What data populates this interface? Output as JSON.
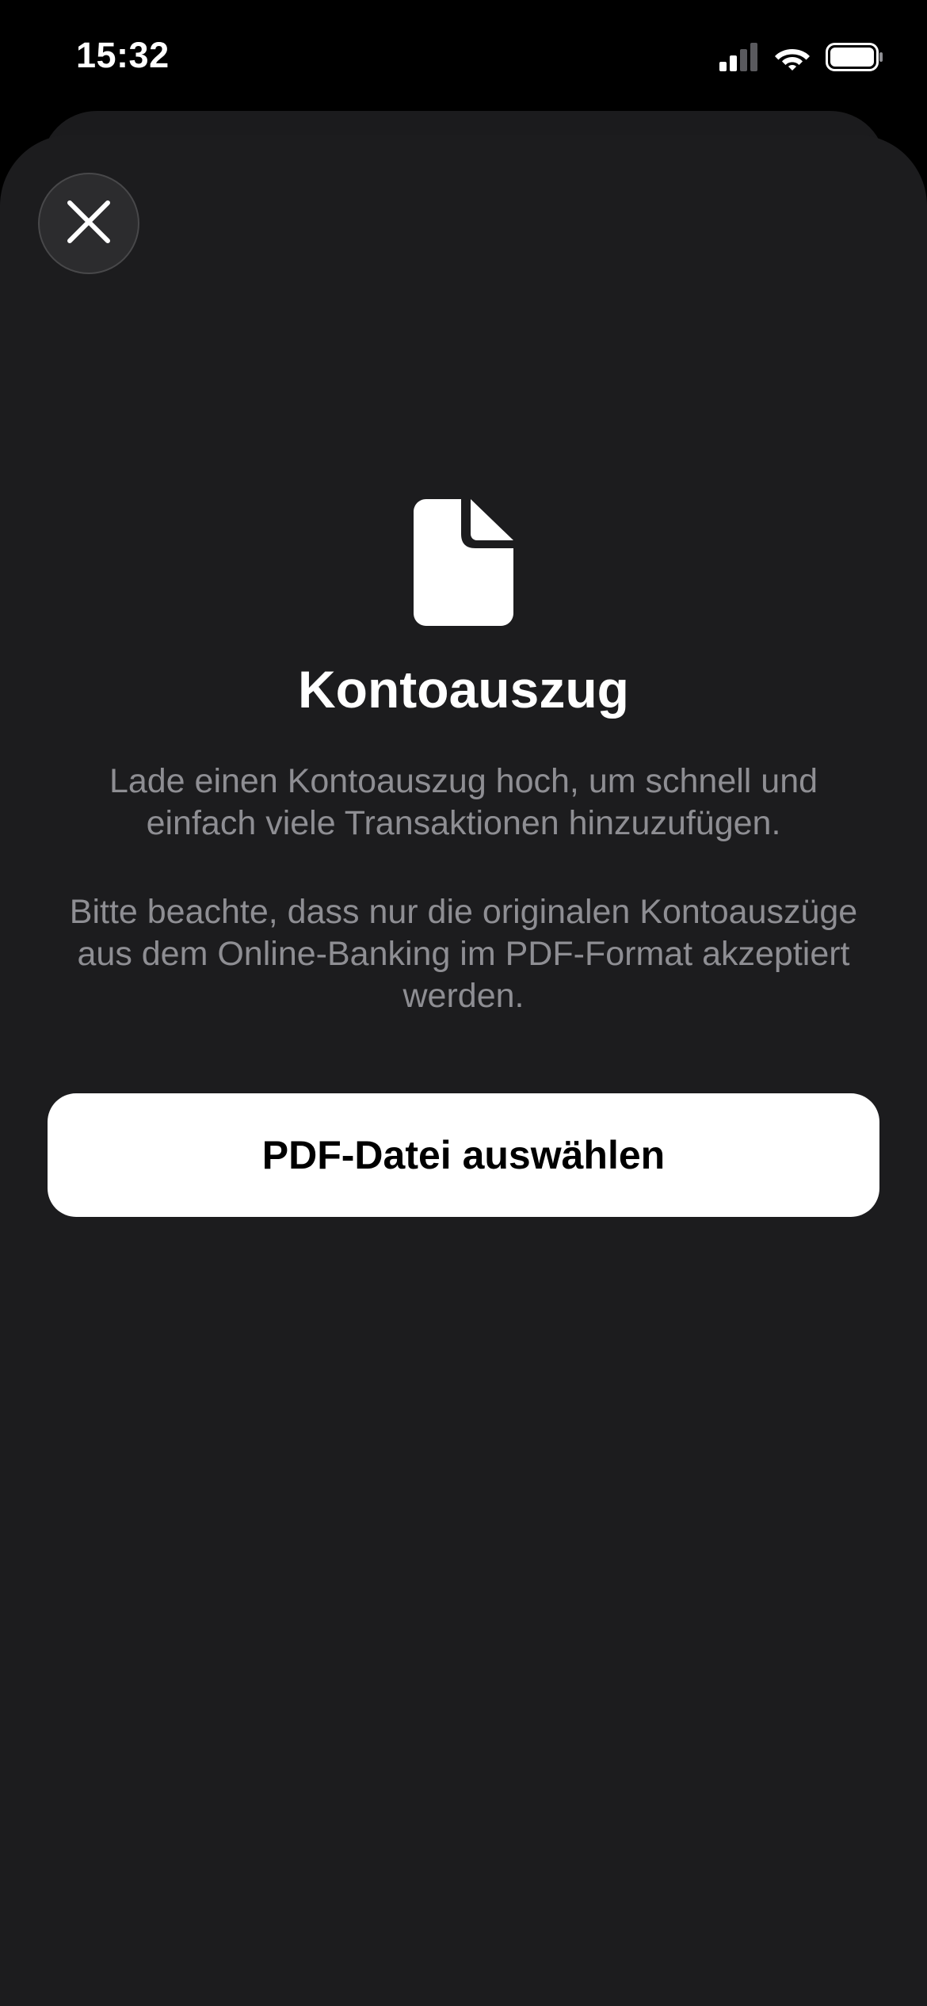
{
  "status_bar": {
    "time": "15:32",
    "icons": [
      "cellular-signal-icon",
      "wifi-icon",
      "battery-icon"
    ]
  },
  "sheet": {
    "close_icon": "close-icon",
    "document_icon": "document-icon",
    "title": "Kontoauszug",
    "description_1": "Lade einen Kontoauszug hoch, um schnell und einfach viele Transaktionen hinzuzufügen.",
    "description_2": "Bitte beachte, dass nur die originalen Kontoauszüge aus dem Online-Banking im PDF-Format akzeptiert werden.",
    "primary_button_label": "PDF-Datei auswählen"
  },
  "colors": {
    "background": "#000000",
    "sheet": "#1c1c1e",
    "secondary_text": "#8e8e93",
    "button_background": "#ffffff",
    "button_text": "#000000"
  }
}
